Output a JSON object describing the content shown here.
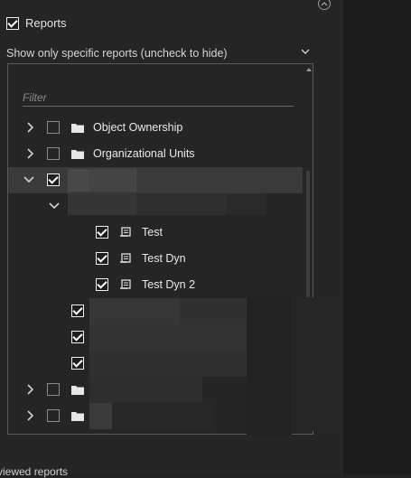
{
  "reports_checkbox": {
    "label": "Reports",
    "checked": true
  },
  "filter_section": {
    "label": "Show only specific reports (uncheck to hide)"
  },
  "filter_input": {
    "placeholder": "Filter",
    "value": ""
  },
  "tree": {
    "object_ownership": {
      "label": "Object Ownership",
      "checked": false,
      "expanded": false
    },
    "organizational_units": {
      "label": "Organizational Units",
      "checked": false,
      "expanded": false
    },
    "redacted_group": {
      "checked": true,
      "expanded": true
    },
    "redacted_subgroup": {
      "expanded": true
    },
    "test": {
      "label": "Test",
      "checked": true
    },
    "test_dyn": {
      "label": "Test Dyn",
      "checked": true
    },
    "test_dyn_2": {
      "label": "Test Dyn 2",
      "checked": true
    },
    "redacted_item_1": {
      "checked": true
    },
    "redacted_item_2": {
      "checked": true
    },
    "redacted_item_3": {
      "checked": true
    },
    "redacted_folder_1": {
      "checked": false,
      "expanded": false
    },
    "redacted_folder_2": {
      "checked": false,
      "expanded": false
    }
  },
  "footer": {
    "viewed_reports_text": "viewed reports"
  },
  "icons": {
    "collapse": "chevron-up-circle-icon",
    "dropdown": "chevron-down-icon",
    "expander_collapsed": "chevron-right-icon",
    "expander_expanded": "chevron-down-icon",
    "folder": "folder-icon",
    "report": "report-icon"
  },
  "colors": {
    "panel_bg": "#252526",
    "selected_row": "#3a3a3a",
    "text": "#e6e6e6"
  }
}
